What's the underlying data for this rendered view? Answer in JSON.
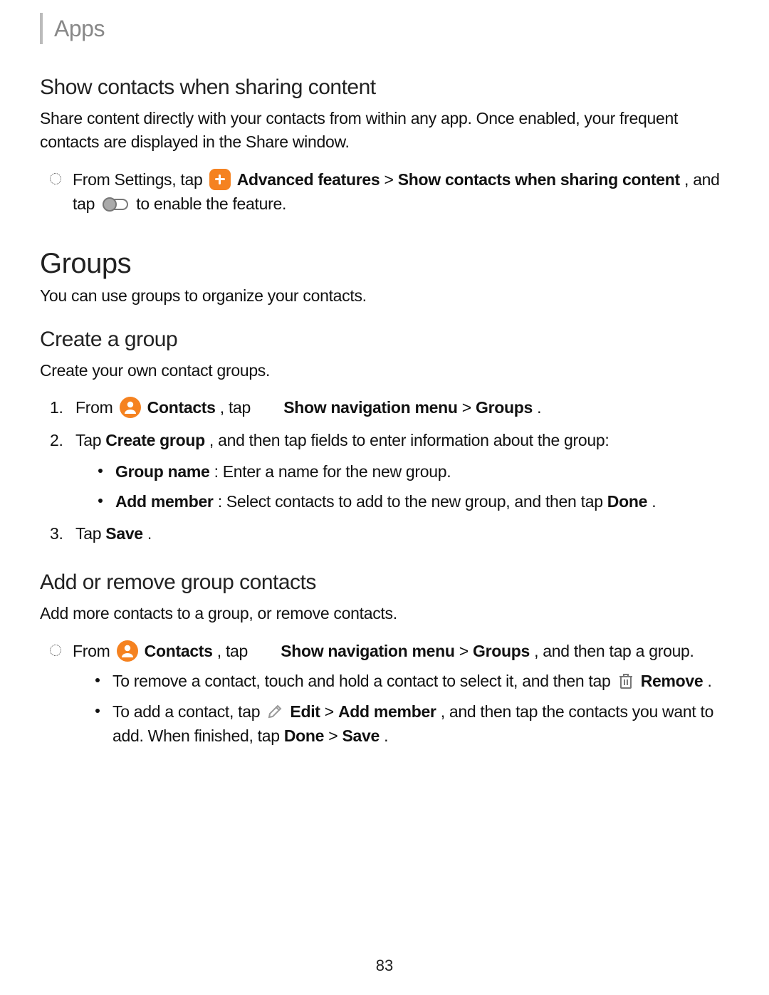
{
  "header": {
    "title": "Apps"
  },
  "page_number": "83",
  "sec1": {
    "heading": "Show contacts when sharing content",
    "intro": "Share content directly with your contacts from within any app. Once enabled, your frequent contacts are displayed in the Share window.",
    "step": {
      "pre": "From Settings, tap ",
      "adv": "Advanced features",
      "gt1": " > ",
      "show": "Show contacts when sharing content",
      "post1": ", and tap ",
      "post2": " to enable the feature."
    }
  },
  "groups": {
    "heading": "Groups",
    "intro": "You can use groups to organize your contacts."
  },
  "create": {
    "heading": "Create a group",
    "intro": "Create your own contact groups.",
    "s1": {
      "pre": "From ",
      "contacts": "Contacts",
      "mid": ", tap ",
      "nav": "Show navigation menu",
      "gt": " > ",
      "groups": "Groups",
      "end": "."
    },
    "s2": {
      "pre": "Tap ",
      "cg": "Create group",
      "post": ", and then tap fields to enter information about the group:",
      "b1_label": "Group name",
      "b1_rest": ": Enter a name for the new group.",
      "b2_label": "Add member",
      "b2_rest": ": Select contacts to add to the new group, and then tap ",
      "b2_done": "Done",
      "b2_end": "."
    },
    "s3": {
      "pre": "Tap ",
      "save": "Save",
      "end": "."
    }
  },
  "addrem": {
    "heading": "Add or remove group contacts",
    "intro": "Add more contacts to a group, or remove contacts.",
    "step": {
      "pre": "From ",
      "contacts": "Contacts",
      "mid": ", tap ",
      "nav": "Show navigation menu",
      "gt": " > ",
      "groups": "Groups",
      "post": ", and then tap a group."
    },
    "r1": {
      "pre": "To remove a contact, touch and hold a contact to select it, and then tap ",
      "remove": "Remove",
      "end": "."
    },
    "r2": {
      "pre": "To add a contact, tap ",
      "edit": "Edit",
      "gt": " > ",
      "addm": "Add member",
      "mid": ", and then tap the contacts you want to add. When finished, tap ",
      "done": "Done",
      "gt2": " > ",
      "save": "Save",
      "end": "."
    }
  }
}
